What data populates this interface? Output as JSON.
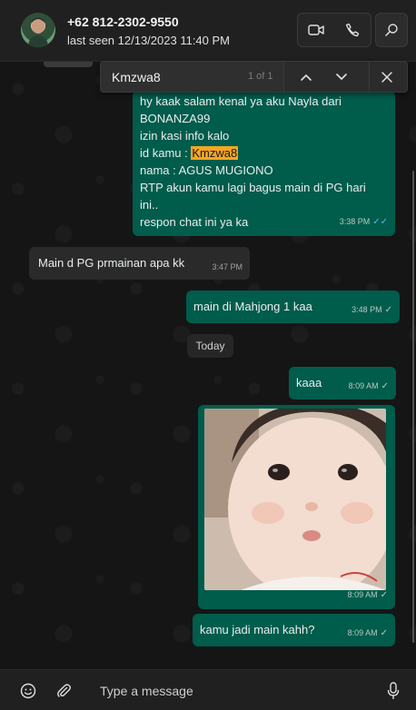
{
  "header": {
    "contact_name": "+62 812-2302-9550",
    "last_seen": "last seen 12/13/2023 11:40 PM"
  },
  "find": {
    "query": "Kmzwa8",
    "count": "1 of 1"
  },
  "messages": {
    "m1": {
      "lines": [
        "hy kaak salam kenal ya aku Nayla dari",
        "BONANZA99",
        "izin kasi info kalo",
        "id kamu : ",
        "nama : AGUS MUGIONO",
        "RTP akun kamu lagi bagus main di PG hari",
        "ini..",
        "respon chat ini ya ka"
      ],
      "highlight": "Kmzwa8",
      "time": "3:38 PM",
      "ticks": "✓✓"
    },
    "m2": {
      "text": "Main d PG prmainan apa kk",
      "time": "3:47 PM"
    },
    "m3": {
      "text": "main di Mahjong 1 kaa",
      "time": "3:48 PM",
      "ticks": "✓"
    },
    "date_divider": "Today",
    "m4": {
      "text": "kaaa",
      "time": "8:09 AM",
      "ticks": "✓"
    },
    "m5": {
      "time": "8:09 AM",
      "ticks": "✓"
    },
    "m6": {
      "text": "kamu jadi main kahh?",
      "time": "8:09 AM",
      "ticks": "✓"
    }
  },
  "composer": {
    "placeholder": "Type a message"
  },
  "colors": {
    "outgoing_bubble": "#005c4b",
    "incoming_bubble": "#2a2a2a",
    "highlight": "#f5a623",
    "read_ticks": "#53bdeb"
  },
  "icons": [
    "video-call-icon",
    "voice-call-icon",
    "search-icon",
    "chevron-up-icon",
    "chevron-down-icon",
    "close-icon",
    "emoji-icon",
    "attach-icon",
    "microphone-icon"
  ]
}
